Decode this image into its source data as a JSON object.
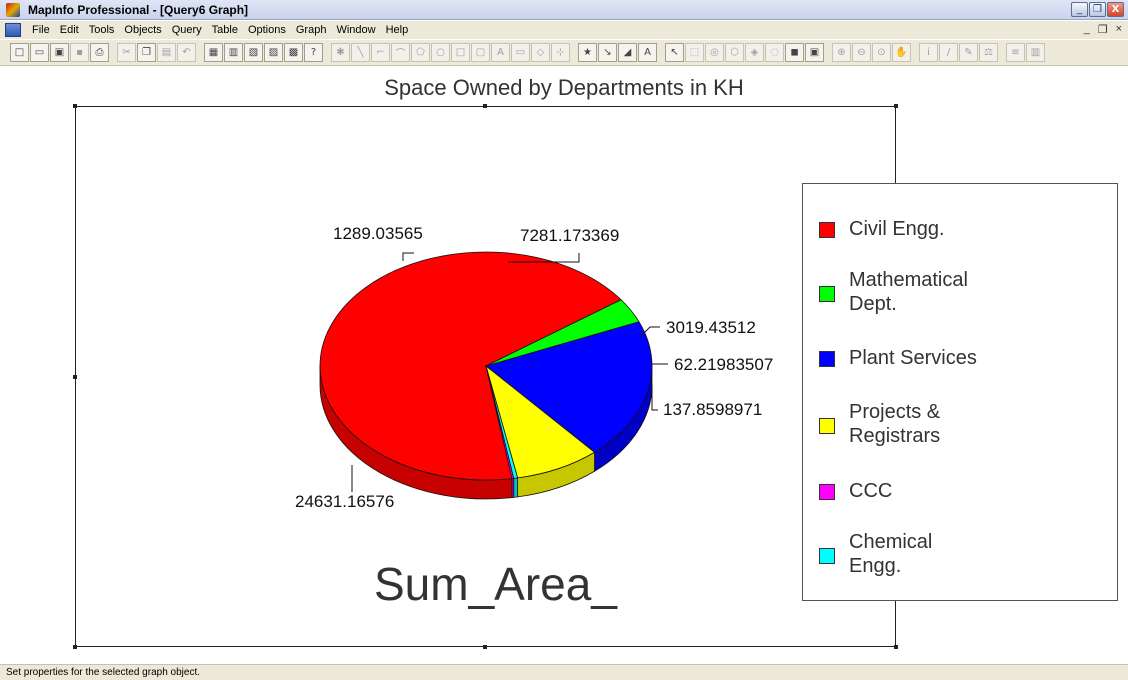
{
  "window": {
    "title": "MapInfo Professional - [Query6 Graph]",
    "controls": [
      "_",
      "❐",
      "X"
    ]
  },
  "menubar": {
    "items": [
      "File",
      "Edit",
      "Tools",
      "Objects",
      "Query",
      "Table",
      "Options",
      "Graph",
      "Window",
      "Help"
    ],
    "mdi_controls": [
      "_",
      "❐",
      "×"
    ]
  },
  "toolbar": {
    "icons": [
      "new-icon",
      "open-icon",
      "open-workspace-icon",
      "save-icon",
      "print-icon",
      "cut-icon",
      "copy-icon",
      "paste-icon",
      "undo-icon",
      "new-browser-icon",
      "new-mapper-icon",
      "new-grapher-icon",
      "new-layout-icon",
      "new-redistrict-icon",
      "help-icon",
      "symbol-icon",
      "line-icon",
      "polyline-icon",
      "arc-icon",
      "polygon-icon",
      "ellipse-icon",
      "rectangle-icon",
      "rounded-rectangle-icon",
      "text-icon",
      "frame-icon",
      "reshape-icon",
      "add-node-icon",
      "symbol-style-icon",
      "line-style-icon",
      "region-style-icon",
      "text-style-icon",
      "select-icon",
      "marquee-select-icon",
      "radius-select-icon",
      "polygon-select-icon",
      "boundary-select-icon",
      "unselect-all-icon",
      "graph-select-icon",
      "zoom-in-icon",
      "zoom-out-icon",
      "change-view-icon",
      "grabber-icon",
      "info-icon",
      "label-icon",
      "drag-map-icon",
      "ruler-icon",
      "legend-icon"
    ]
  },
  "graph": {
    "title": "Space Owned by Departments in KH",
    "series_label": "Sum_Area_"
  },
  "chart_data": {
    "type": "pie",
    "title": "Space Owned by Departments in KH",
    "xlabel": "Sum_Area_",
    "legend_placement": "right",
    "categories": [
      "Civil Engg.",
      "Mathematical Dept.",
      "Plant Services",
      "Projects & Registrars",
      "CCC",
      "Chemical Engg."
    ],
    "values": [
      24631.16576,
      1289.03565,
      7281.173369,
      3019.43512,
      62.21983507,
      137.8598971
    ],
    "data_labels": [
      "24631.16576",
      "1289.03565",
      "7281.173369",
      "3019.43512",
      "62.21983507",
      "137.8598971"
    ],
    "colors": [
      "#ff0000",
      "#00ff00",
      "#0000ff",
      "#ffff00",
      "#ff00ff",
      "#00ffff"
    ]
  },
  "legend": {
    "items": [
      {
        "label": "Civil Engg.",
        "color": "#ff0000"
      },
      {
        "label": "Mathematical Dept.",
        "color": "#00ff00"
      },
      {
        "label": "Plant Services",
        "color": "#0000ff"
      },
      {
        "label": "Projects & Registrars",
        "color": "#ffff00"
      },
      {
        "label": "CCC",
        "color": "#ff00ff"
      },
      {
        "label": "Chemical Engg.",
        "color": "#00ffff"
      }
    ]
  },
  "statusbar": {
    "text": "Set properties for the selected graph object."
  }
}
